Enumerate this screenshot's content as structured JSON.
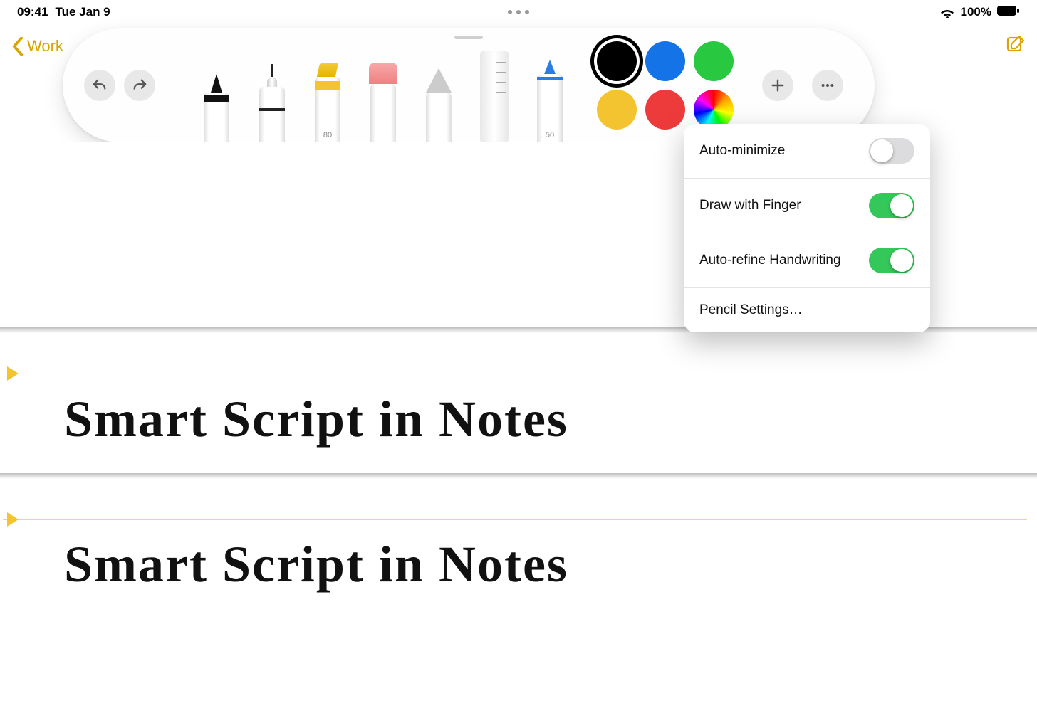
{
  "status": {
    "time": "09:41",
    "date": "Tue Jan 9",
    "battery_pct": "100%"
  },
  "nav": {
    "back_label": "Work"
  },
  "palette": {
    "highlighter_opacity": "80",
    "pencil_opacity": "50",
    "colors": {
      "black": "#000000",
      "blue": "#1473e6",
      "green": "#28c840",
      "yellow": "#f4c430",
      "red": "#ed3b3b"
    }
  },
  "popover": {
    "items": [
      {
        "label": "Auto-minimize",
        "on": false
      },
      {
        "label": "Draw with Finger",
        "on": true
      },
      {
        "label": "Auto-refine Handwriting",
        "on": true
      }
    ],
    "pencil_settings": "Pencil Settings…"
  },
  "handwriting": "Smart  Script  in  Notes"
}
